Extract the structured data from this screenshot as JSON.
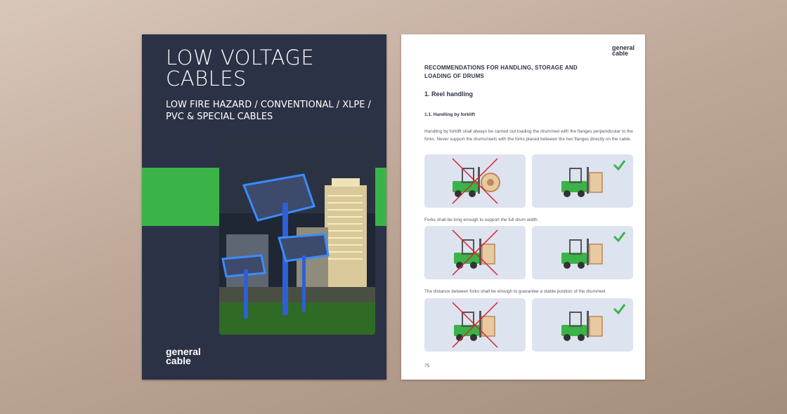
{
  "cover": {
    "title": "LOW VOLTAGE CABLES",
    "subtitle": "LOW FIRE HAZARD / CONVENTIONAL / XLPE / PVC & SPECIAL CABLES",
    "logo_line1": "general",
    "logo_line2": "cable",
    "colors": {
      "background": "#2c3245",
      "accent": "#3ab449"
    }
  },
  "page": {
    "logo_line1": "general",
    "logo_line2": "cable",
    "heading": "RECOMMENDATIONS FOR HANDLING, STORAGE AND LOADING OF DRUMS",
    "section_title": "1. Reel handling",
    "subsection_title": "1.1. Handling by forklift",
    "paragraph_1": "Handling by forklift shall always be carried out loading the drum/reel with the flanges perpendicular to the forks. Never support the drums/reels with the forks placed between the two flanges directly on the cable.",
    "paragraph_2": "Forks shall be long enough to support the full drum width.",
    "paragraph_3": "The distance between forks shall be enough to guarantee a stable position of the drum/reel.",
    "page_number": "75",
    "illustrations": [
      {
        "row": 1,
        "wrong": "forklift-drum-wrong",
        "right": "forklift-drum-correct"
      },
      {
        "row": 2,
        "wrong": "forklift-short-forks-wrong",
        "right": "forklift-long-forks-correct"
      },
      {
        "row": 3,
        "wrong": "forklift-narrow-forks-wrong",
        "right": "forklift-wide-forks-correct"
      }
    ],
    "colors": {
      "wrong_mark": "#d9232d",
      "check_mark": "#3ab449",
      "forklift": "#3ab449",
      "box_bg": "#dde3ef"
    }
  }
}
